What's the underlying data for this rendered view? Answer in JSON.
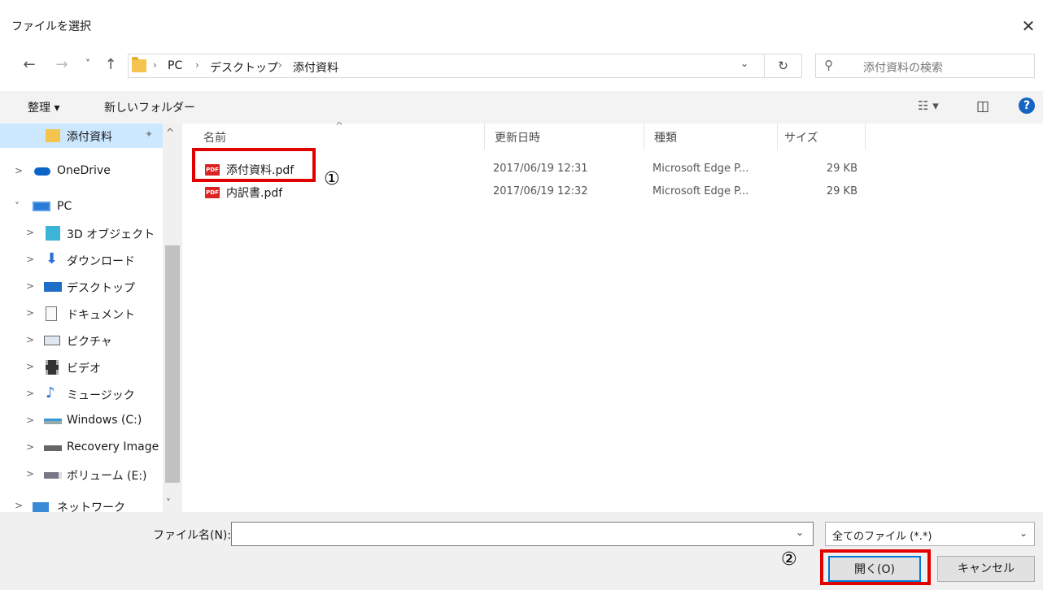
{
  "dialog": {
    "title": "ファイルを選択"
  },
  "icons": {
    "close": "✕",
    "back": "←",
    "forward": "→",
    "recent": "˅",
    "up": "↑",
    "refresh": "↻",
    "search": "⚲",
    "chev_right": "›",
    "chev_down": "˅",
    "dropdown": "⌄",
    "pin": "📌",
    "scroll_up": "^",
    "scroll_down": "˅",
    "sort_up": "^"
  },
  "address": {
    "crumbs": [
      "PC",
      "デスクトップ",
      "添付資料"
    ]
  },
  "search": {
    "placeholder": "添付資料の検索"
  },
  "toolbar": {
    "organize": "整理 ▾",
    "new_folder": "新しいフォルダー",
    "view_icon": "☷ ▾",
    "pane_icon": "◫",
    "help": "?"
  },
  "navpane": {
    "items": [
      {
        "label": "添付資料",
        "selected": true,
        "chev": "",
        "icon": "folder"
      },
      {
        "label": "OneDrive",
        "chev": ">",
        "icon": "cloud"
      },
      {
        "label": "PC",
        "chev": "˅",
        "icon": "pc"
      },
      {
        "label": "3D オブジェクト",
        "chev": ">",
        "icon": "3d"
      },
      {
        "label": "ダウンロード",
        "chev": ">",
        "icon": "download"
      },
      {
        "label": "デスクトップ",
        "chev": ">",
        "icon": "desktop"
      },
      {
        "label": "ドキュメント",
        "chev": ">",
        "icon": "doc"
      },
      {
        "label": "ピクチャ",
        "chev": ">",
        "icon": "picture"
      },
      {
        "label": "ビデオ",
        "chev": ">",
        "icon": "video"
      },
      {
        "label": "ミュージック",
        "chev": ">",
        "icon": "music"
      },
      {
        "label": "Windows (C:)",
        "chev": ">",
        "icon": "drive"
      },
      {
        "label": "Recovery Image",
        "chev": ">",
        "icon": "drive"
      },
      {
        "label": "ボリューム (E:)",
        "chev": ">",
        "icon": "usb"
      },
      {
        "label": "ネットワーク",
        "chev": ">",
        "icon": "network"
      }
    ]
  },
  "columns": {
    "name": "名前",
    "date": "更新日時",
    "type": "種類",
    "size": "サイズ"
  },
  "files": [
    {
      "name": "添付資料.pdf",
      "date": "2017/06/19 12:31",
      "type": "Microsoft Edge P...",
      "size": "29 KB",
      "icon_text": "PDF"
    },
    {
      "name": "内訳書.pdf",
      "date": "2017/06/19 12:32",
      "type": "Microsoft Edge P...",
      "size": "29 KB",
      "icon_text": "PDF"
    }
  ],
  "callouts": {
    "one": "①",
    "two": "②"
  },
  "bottom": {
    "filename_label": "ファイル名(N):",
    "filename_value": "",
    "filetype": "全てのファイル (*.*)",
    "open": "開く(O)",
    "cancel": "キャンセル"
  },
  "colors": {
    "highlight": "#e00000",
    "selected_bg": "#cce8ff",
    "accent": "#0078d7"
  }
}
